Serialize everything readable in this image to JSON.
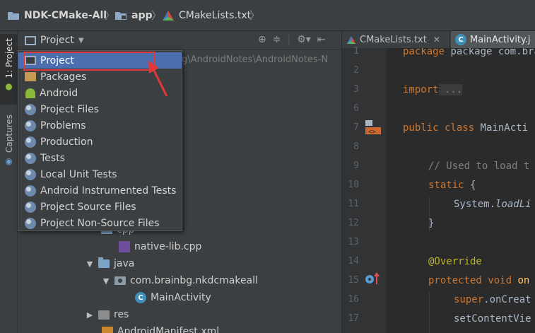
{
  "breadcrumb": {
    "project": "NDK-CMake-All",
    "module": "app",
    "file": "CMakeLists.txt"
  },
  "tool_window": {
    "tab_project": "1: Project",
    "tab_captures": "Captures",
    "header_title": "Project",
    "header_icons": [
      "target-icon",
      "collapse-icon",
      "gear-icon",
      "hide-icon"
    ]
  },
  "background": {
    "path_text": "g\\AndroidNotes\\AndroidNotes-N"
  },
  "view_menu": {
    "selected": "Project",
    "items": [
      {
        "label": "Project",
        "icon": "project-icon"
      },
      {
        "label": "Packages",
        "icon": "packages-icon"
      },
      {
        "label": "Android",
        "icon": "android-icon"
      },
      {
        "label": "Project Files",
        "icon": "scope-icon"
      },
      {
        "label": "Problems",
        "icon": "scope-icon"
      },
      {
        "label": "Production",
        "icon": "scope-icon"
      },
      {
        "label": "Tests",
        "icon": "scope-icon"
      },
      {
        "label": "Local Unit Tests",
        "icon": "scope-icon"
      },
      {
        "label": "Android Instrumented Tests",
        "icon": "scope-icon"
      },
      {
        "label": "Project Source Files",
        "icon": "scope-icon"
      },
      {
        "label": "Project Non-Source Files",
        "icon": "scope-icon"
      }
    ]
  },
  "tree": {
    "cpp_folder": "cpp",
    "cpp_file": "native-lib.cpp",
    "java_folder": "java",
    "package": "com.brainbg.nkdcmakeall",
    "main_class": "MainActivity",
    "res_folder": "res",
    "manifest": "AndroidManifest.xml"
  },
  "editor": {
    "tabs": [
      {
        "label": "CMakeLists.txt",
        "active": false
      },
      {
        "label": "MainActivity.j",
        "active": true
      }
    ],
    "line_numbers": [
      "1",
      "2",
      "3",
      "6",
      "7",
      "8",
      "9",
      "10",
      "11",
      "12",
      "13",
      "14",
      "15",
      "16",
      "17"
    ],
    "code": {
      "l1": "package com.brainbg.n",
      "l3_kw": "import",
      "l3_rest": " ...",
      "l7_kw": "public class ",
      "l7_rest": "MainActi",
      "l9": "// Used to load t",
      "l10_kw": "static",
      "l10_rest": " {",
      "l11_obj": "System.",
      "l11_call": "loadLi",
      "l12": "}",
      "l14": "@Override",
      "l15_kw": "protected void ",
      "l15_fn": "on",
      "l16_kw": "super",
      "l16_rest": ".onCreat",
      "l17": "setContentVie"
    }
  }
}
